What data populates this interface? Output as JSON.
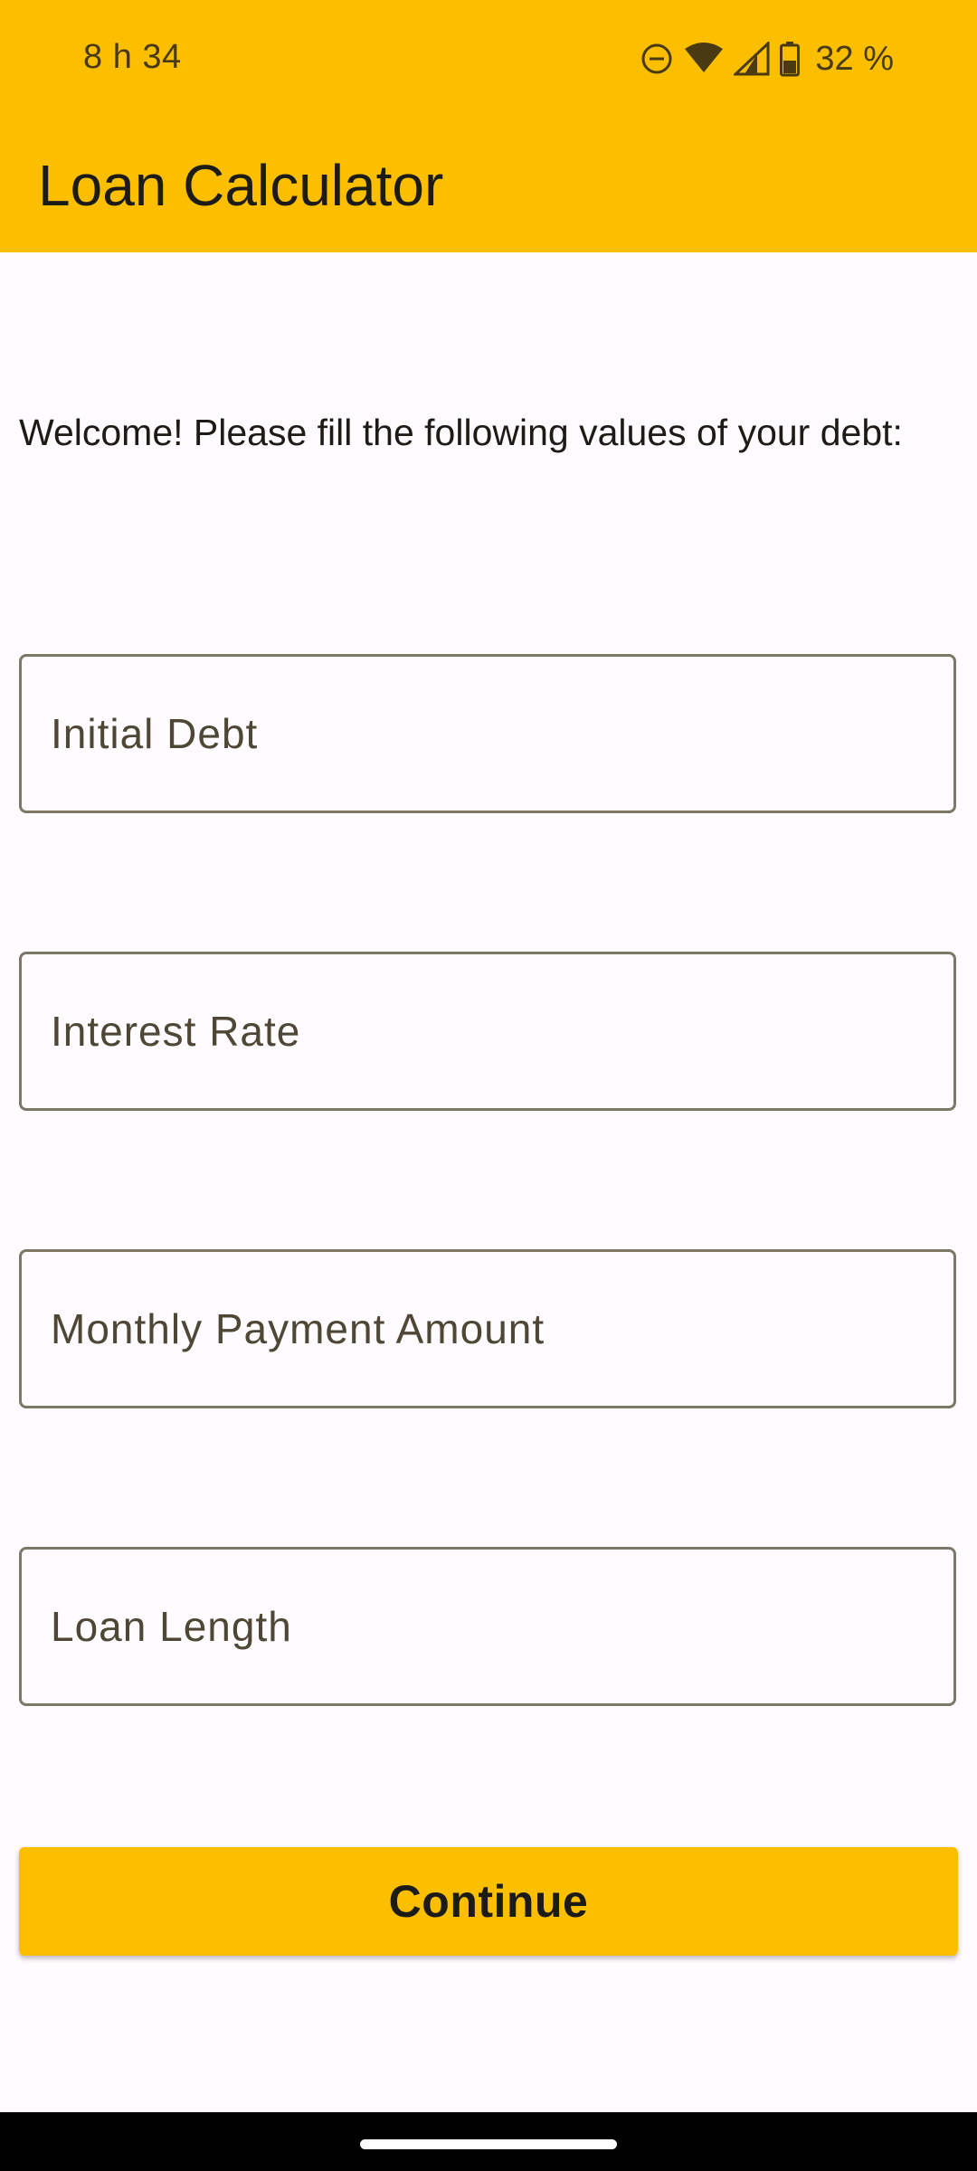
{
  "status_bar": {
    "time": "8 h 34",
    "battery_text": "32 %",
    "icons": [
      "do-not-disturb-icon",
      "wifi-icon",
      "cell-signal-icon",
      "battery-icon"
    ]
  },
  "app_bar": {
    "title": "Loan Calculator"
  },
  "form": {
    "welcome": "Welcome! Please fill the following values of your debt:",
    "fields": [
      {
        "placeholder": "Initial Debt",
        "value": ""
      },
      {
        "placeholder": "Interest Rate",
        "value": ""
      },
      {
        "placeholder": "Monthly Payment Amount",
        "value": ""
      },
      {
        "placeholder": "Loan Length",
        "value": ""
      }
    ],
    "continue_label": "Continue"
  },
  "colors": {
    "accent": "#fbbf00",
    "background": "#fffbfe",
    "text": "#1d1b16",
    "outline": "#7c7766"
  }
}
